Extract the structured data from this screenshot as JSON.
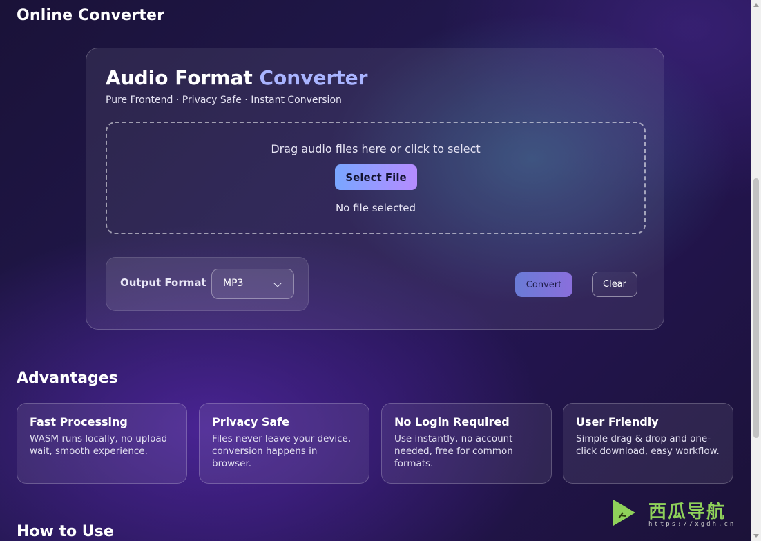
{
  "header": {
    "title": "Online Converter"
  },
  "converter": {
    "title_main": "Audio Format",
    "title_accent": "Converter",
    "subtitle": "Pure Frontend · Privacy Safe · Instant Conversion",
    "dropzone_text": "Drag audio files here or click to select",
    "select_button": "Select File",
    "file_status": "No file selected",
    "output_format_label": "Output Format",
    "output_format_value": "MP3",
    "convert_button": "Convert",
    "clear_button": "Clear"
  },
  "advantages": {
    "title": "Advantages",
    "items": [
      {
        "title": "Fast Processing",
        "desc": "WASM runs locally, no upload wait, smooth experience."
      },
      {
        "title": "Privacy Safe",
        "desc": "Files never leave your device, conversion happens in browser."
      },
      {
        "title": "No Login Required",
        "desc": "Use instantly, no account needed, free for common formats."
      },
      {
        "title": "User Friendly",
        "desc": "Simple drag & drop and one-click download, easy workflow."
      }
    ]
  },
  "how_to_use": {
    "title": "How to Use"
  },
  "watermark": {
    "text": "西瓜导航",
    "url": "https://xgdh.cn"
  },
  "colors": {
    "accent": "#a9b4ff",
    "button_gradient_start": "#79a6ff",
    "button_gradient_end": "#b58cff",
    "watermark": "#8fd15a"
  }
}
